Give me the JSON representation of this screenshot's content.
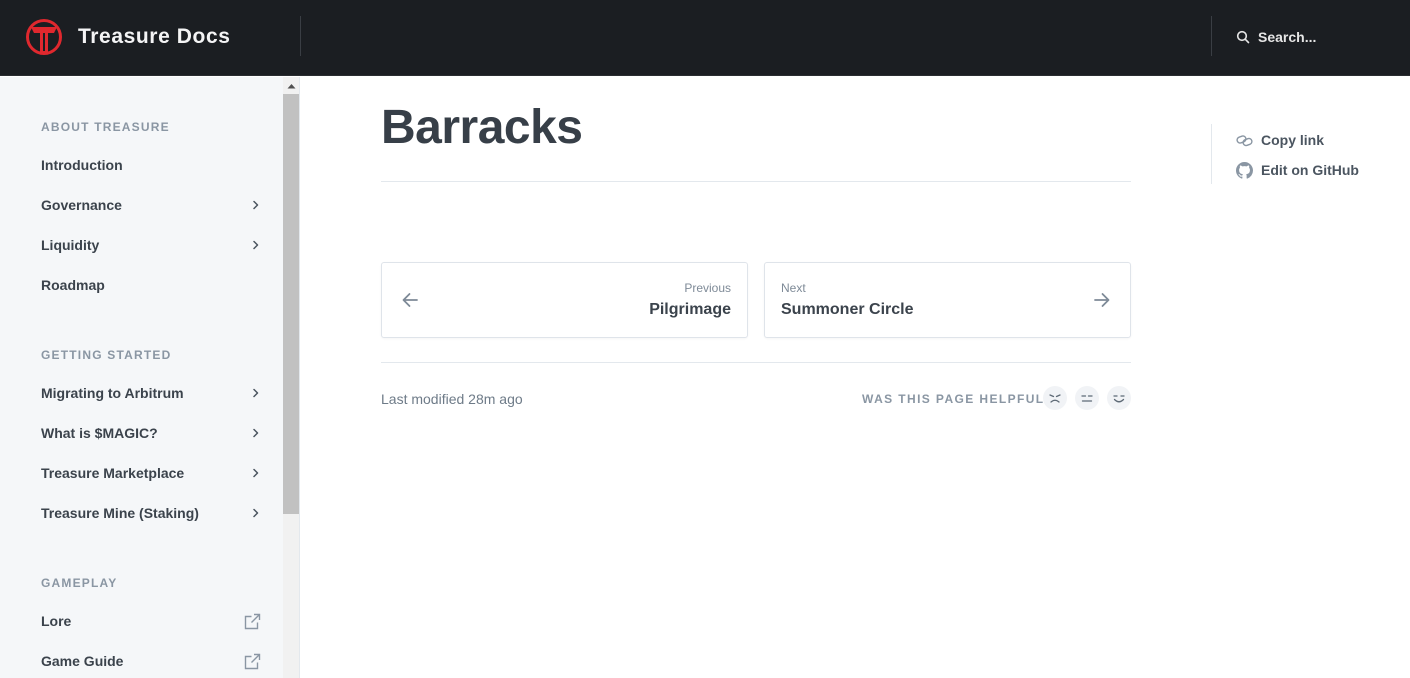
{
  "header": {
    "brand_name": "Treasure Docs",
    "search_placeholder": "Search..."
  },
  "sidebar": {
    "sections": [
      {
        "title": "ABOUT TREASURE",
        "items": [
          {
            "label": "Introduction",
            "icon": ""
          },
          {
            "label": "Governance",
            "icon": "chevron-right-icon"
          },
          {
            "label": "Liquidity",
            "icon": "chevron-right-icon"
          },
          {
            "label": "Roadmap",
            "icon": ""
          }
        ]
      },
      {
        "title": "GETTING STARTED",
        "items": [
          {
            "label": "Migrating to Arbitrum",
            "icon": "chevron-right-icon"
          },
          {
            "label": "What is $MAGIC?",
            "icon": "chevron-right-icon"
          },
          {
            "label": "Treasure Marketplace",
            "icon": "chevron-right-icon"
          },
          {
            "label": "Treasure Mine (Staking)",
            "icon": "chevron-right-icon"
          }
        ]
      },
      {
        "title": "GAMEPLAY",
        "items": [
          {
            "label": "Lore",
            "icon": "external-link-icon"
          },
          {
            "label": "Game Guide",
            "icon": "external-link-icon"
          }
        ]
      }
    ]
  },
  "main": {
    "title": "Barracks",
    "previous": {
      "caption": "Previous",
      "label": "Pilgrimage"
    },
    "next": {
      "caption": "Next",
      "label": "Summoner Circle"
    },
    "last_modified": "Last modified 28m ago",
    "helpful_prompt": "WAS THIS PAGE HELPFUL?"
  },
  "page_actions": {
    "copy_link": "Copy link",
    "edit_github": "Edit on GitHub"
  },
  "colors": {
    "header_bg": "#1b1e22",
    "brand_red": "#e0282e",
    "sidebar_bg": "#f5f7f9",
    "text_primary": "#3b434c",
    "text_muted": "#8a96a3"
  }
}
